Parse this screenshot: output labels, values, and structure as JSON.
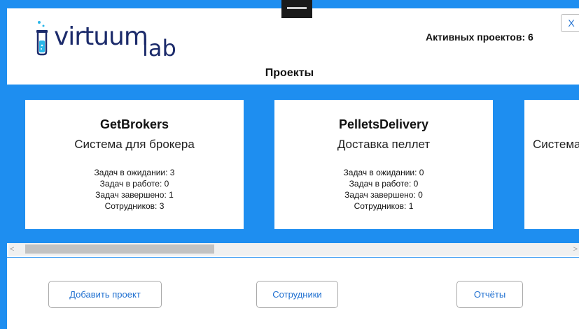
{
  "app": {
    "logo_main": "virtuum",
    "logo_sub": "lab",
    "close_label": "X",
    "active_projects": "Активных проектов: 6"
  },
  "section_title": "Проекты",
  "projects": [
    {
      "name": "GetBrokers",
      "description": "Система для брокера",
      "stats": [
        "Задач в ожидании: 3",
        "Задач в работе: 0",
        "Задач завершено: 1",
        "Сотрудников: 3"
      ]
    },
    {
      "name": "PelletsDelivery",
      "description": "Доставка пеллет",
      "stats": [
        "Задач в ожидании: 0",
        "Задач в работе: 0",
        "Задач завершено: 0",
        "Сотрудников: 1"
      ]
    },
    {
      "name": "",
      "description": "Система",
      "stats": []
    }
  ],
  "buttons": {
    "add_project": "Добавить проект",
    "employees": "Сотрудники",
    "reports": "Отчёты"
  },
  "scrollbar": {
    "left_arrow": "<",
    "right_arrow": ">"
  },
  "colors": {
    "accent": "#1e8ef0",
    "brand": "#1c2b6b",
    "button_text": "#1e6fd0"
  }
}
